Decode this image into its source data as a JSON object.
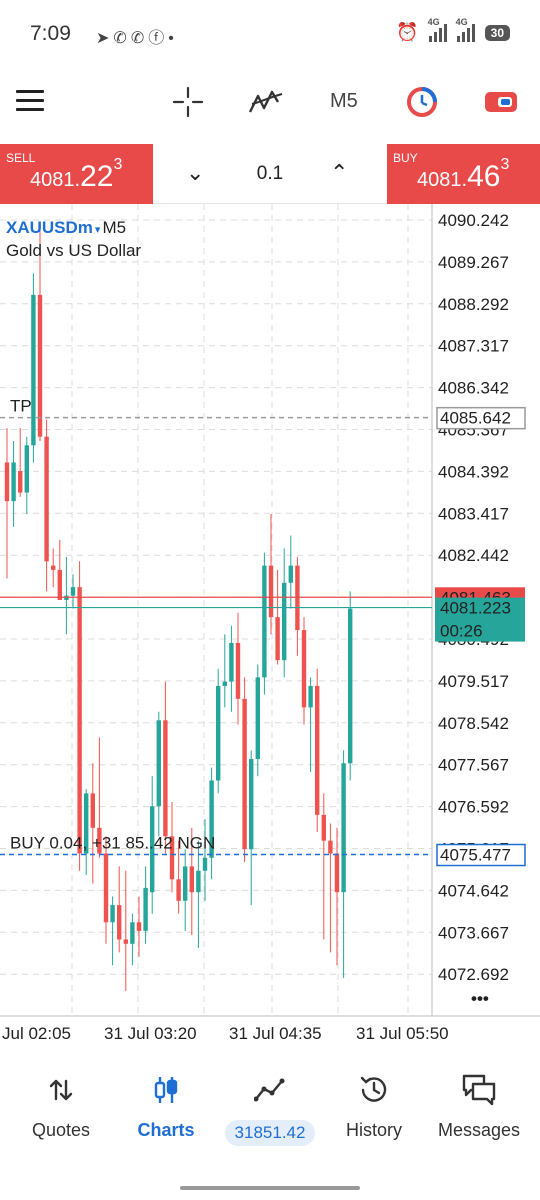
{
  "status_bar": {
    "time": "7:09",
    "app_icons": [
      "telegram-icon",
      "whatsapp-icon",
      "whatsapp-business-icon",
      "facebook-icon",
      "dot"
    ],
    "network_1": "4G",
    "network_2": "4G",
    "battery": "30"
  },
  "toolbar": {
    "timeframe": "M5"
  },
  "trade": {
    "sell_label": "SELL",
    "sell_price_small": "4081.",
    "sell_price_big": "22",
    "sell_price_sup": "3",
    "lot": "0.1",
    "buy_label": "BUY",
    "buy_price_small": "4081.",
    "buy_price_big": "46",
    "buy_price_sup": "3"
  },
  "symbol": {
    "name": "XAUUSDm",
    "arrow": "▾",
    "timeframe": "M5",
    "description": "Gold vs US Dollar"
  },
  "colors": {
    "bull": "#26a69a",
    "bear": "#ef5350",
    "ask_line": "#e84a4a",
    "bid_line": "#26a69a",
    "position_line": "#1e6ed4",
    "tp_line": "#9a9a9a",
    "grid": "#dcdcdc"
  },
  "chart_data": {
    "type": "candlestick",
    "price_labels": [
      "4090.242",
      "4089.267",
      "4088.292",
      "4087.317",
      "4086.342",
      "4085.367",
      "4084.392",
      "4083.417",
      "4082.442",
      "4081.467",
      "4080.492",
      "4079.517",
      "4078.542",
      "4077.567",
      "4076.592",
      "4075.617",
      "4074.642",
      "4073.667",
      "4072.692"
    ],
    "time_labels": [
      "Jul 02:05",
      "31 Jul 03:20",
      "31 Jul 04:35",
      "31 Jul 05:50"
    ],
    "ask": "4081.463",
    "bid": "4081.223",
    "bar_timer": "00:26",
    "tp_label": "TP",
    "tp_price": "4085.642",
    "position_text": "BUY 0.04, +31 85..42 NGN",
    "position_price": "4075.477",
    "candles": [
      {
        "o": 4084.6,
        "h": 4085.4,
        "l": 4081.9,
        "c": 4083.7
      },
      {
        "o": 4083.7,
        "h": 4085.1,
        "l": 4083.1,
        "c": 4084.6
      },
      {
        "o": 4084.4,
        "h": 4085.4,
        "l": 4083.8,
        "c": 4083.9
      },
      {
        "o": 4083.9,
        "h": 4085.2,
        "l": 4083.4,
        "c": 4085.0
      },
      {
        "o": 4085.0,
        "h": 4089.0,
        "l": 4084.6,
        "c": 4088.5
      },
      {
        "o": 4088.5,
        "h": 4090.2,
        "l": 4085.1,
        "c": 4085.2
      },
      {
        "o": 4085.2,
        "h": 4085.6,
        "l": 4081.6,
        "c": 4082.3
      },
      {
        "o": 4082.2,
        "h": 4082.6,
        "l": 4081.7,
        "c": 4082.1
      },
      {
        "o": 4082.1,
        "h": 4082.8,
        "l": 4081.6,
        "c": 4081.4
      },
      {
        "o": 4081.4,
        "h": 4082.4,
        "l": 4080.6,
        "c": 4081.5
      },
      {
        "o": 4081.5,
        "h": 4082.0,
        "l": 4081.2,
        "c": 4081.7
      },
      {
        "o": 4081.7,
        "h": 4082.3,
        "l": 4075.1,
        "c": 4075.5
      },
      {
        "o": 4075.5,
        "h": 4077.0,
        "l": 4075.0,
        "c": 4076.9
      },
      {
        "o": 4076.9,
        "h": 4077.6,
        "l": 4074.8,
        "c": 4076.1
      },
      {
        "o": 4076.1,
        "h": 4078.2,
        "l": 4075.4,
        "c": 4075.5
      },
      {
        "o": 4075.5,
        "h": 4075.9,
        "l": 4073.4,
        "c": 4073.9
      },
      {
        "o": 4073.9,
        "h": 4074.5,
        "l": 4072.9,
        "c": 4074.3
      },
      {
        "o": 4074.3,
        "h": 4075.2,
        "l": 4073.2,
        "c": 4073.5
      },
      {
        "o": 4073.5,
        "h": 4075.1,
        "l": 4072.3,
        "c": 4073.4
      },
      {
        "o": 4073.4,
        "h": 4074.1,
        "l": 4072.9,
        "c": 4073.9
      },
      {
        "o": 4073.9,
        "h": 4074.5,
        "l": 4073.1,
        "c": 4073.7
      },
      {
        "o": 4073.7,
        "h": 4075.2,
        "l": 4073.4,
        "c": 4074.7
      },
      {
        "o": 4074.6,
        "h": 4077.3,
        "l": 4074.1,
        "c": 4076.6
      },
      {
        "o": 4076.6,
        "h": 4078.8,
        "l": 4075.9,
        "c": 4078.6
      },
      {
        "o": 4078.6,
        "h": 4079.5,
        "l": 4075.5,
        "c": 4075.9
      },
      {
        "o": 4075.9,
        "h": 4076.7,
        "l": 4074.6,
        "c": 4074.9
      },
      {
        "o": 4074.9,
        "h": 4075.8,
        "l": 4074.1,
        "c": 4074.4
      },
      {
        "o": 4074.4,
        "h": 4075.6,
        "l": 4073.7,
        "c": 4075.2
      },
      {
        "o": 4075.2,
        "h": 4076.1,
        "l": 4073.6,
        "c": 4074.6
      },
      {
        "o": 4074.6,
        "h": 4075.8,
        "l": 4073.3,
        "c": 4075.1
      },
      {
        "o": 4075.1,
        "h": 4076.3,
        "l": 4074.4,
        "c": 4075.4
      },
      {
        "o": 4075.4,
        "h": 4077.5,
        "l": 4074.9,
        "c": 4077.2
      },
      {
        "o": 4077.2,
        "h": 4079.8,
        "l": 4076.9,
        "c": 4079.4
      },
      {
        "o": 4079.4,
        "h": 4080.6,
        "l": 4078.9,
        "c": 4079.5
      },
      {
        "o": 4079.5,
        "h": 4080.8,
        "l": 4078.8,
        "c": 4080.4
      },
      {
        "o": 4080.4,
        "h": 4081.1,
        "l": 4078.5,
        "c": 4079.1
      },
      {
        "o": 4079.1,
        "h": 4079.6,
        "l": 4075.3,
        "c": 4075.6
      },
      {
        "o": 4075.6,
        "h": 4077.9,
        "l": 4074.3,
        "c": 4077.7
      },
      {
        "o": 4077.7,
        "h": 4079.9,
        "l": 4077.3,
        "c": 4079.6
      },
      {
        "o": 4079.6,
        "h": 4082.5,
        "l": 4079.2,
        "c": 4082.2
      },
      {
        "o": 4082.2,
        "h": 4083.4,
        "l": 4080.6,
        "c": 4081.0
      },
      {
        "o": 4081.0,
        "h": 4082.1,
        "l": 4079.9,
        "c": 4080.0
      },
      {
        "o": 4080.0,
        "h": 4082.6,
        "l": 4079.6,
        "c": 4081.8
      },
      {
        "o": 4081.8,
        "h": 4082.9,
        "l": 4081.2,
        "c": 4082.2
      },
      {
        "o": 4082.2,
        "h": 4082.4,
        "l": 4080.1,
        "c": 4080.7
      },
      {
        "o": 4080.7,
        "h": 4081.0,
        "l": 4078.5,
        "c": 4078.9
      },
      {
        "o": 4078.9,
        "h": 4079.6,
        "l": 4077.4,
        "c": 4079.4
      },
      {
        "o": 4079.4,
        "h": 4079.8,
        "l": 4076.0,
        "c": 4076.4
      },
      {
        "o": 4076.4,
        "h": 4076.9,
        "l": 4073.5,
        "c": 4075.8
      },
      {
        "o": 4075.8,
        "h": 4076.2,
        "l": 4073.2,
        "c": 4075.5
      },
      {
        "o": 4075.5,
        "h": 4076.1,
        "l": 4072.9,
        "c": 4074.6
      },
      {
        "o": 4074.6,
        "h": 4077.9,
        "l": 4072.6,
        "c": 4077.6
      },
      {
        "o": 4077.6,
        "h": 4081.6,
        "l": 4077.2,
        "c": 4081.2
      }
    ]
  },
  "more_menu": "•••",
  "bottom_nav": {
    "quotes": "Quotes",
    "charts": "Charts",
    "balance": "31851.42",
    "history": "History",
    "messages": "Messages"
  }
}
